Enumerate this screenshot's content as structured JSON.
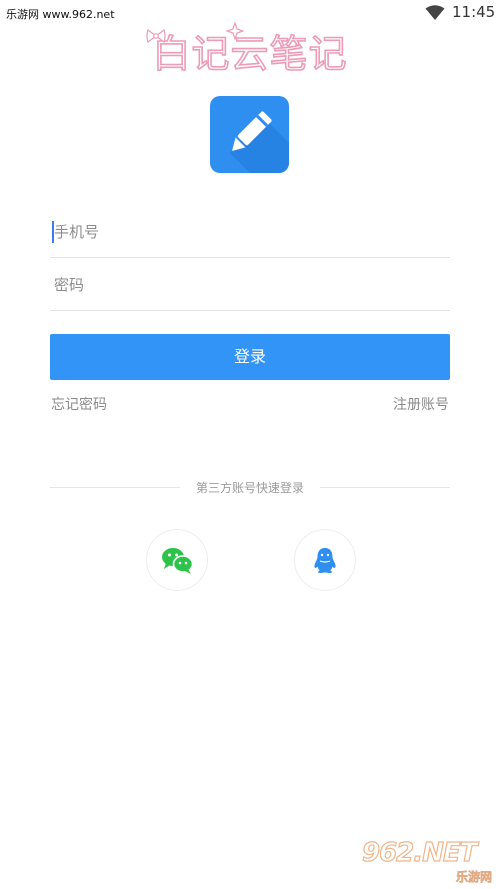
{
  "status_bar": {
    "site_label": "乐游网 www.962.net",
    "time": "11:45",
    "wifi_icon": "wifi-icon"
  },
  "brand": {
    "title": "白记云笔记",
    "title_color": "#ec9cb6"
  },
  "app_icon": {
    "icon": "pencil-icon",
    "color": "#2f8ff0"
  },
  "form": {
    "phone_placeholder": "手机号",
    "phone_value": "",
    "password_placeholder": "密码",
    "password_value": "",
    "login_label": "登录",
    "forgot_label": "忘记密码",
    "register_label": "注册账号"
  },
  "third_party": {
    "divider_label": "第三方账号快速登录",
    "options": [
      {
        "icon": "wechat-icon",
        "color": "#2dc34a"
      },
      {
        "icon": "qq-icon",
        "color": "#2f8ff0"
      }
    ]
  },
  "watermark": {
    "logo": "962.NET",
    "sub": "乐游网"
  },
  "colors": {
    "accent": "#3294f7",
    "background": "#ffffff"
  }
}
